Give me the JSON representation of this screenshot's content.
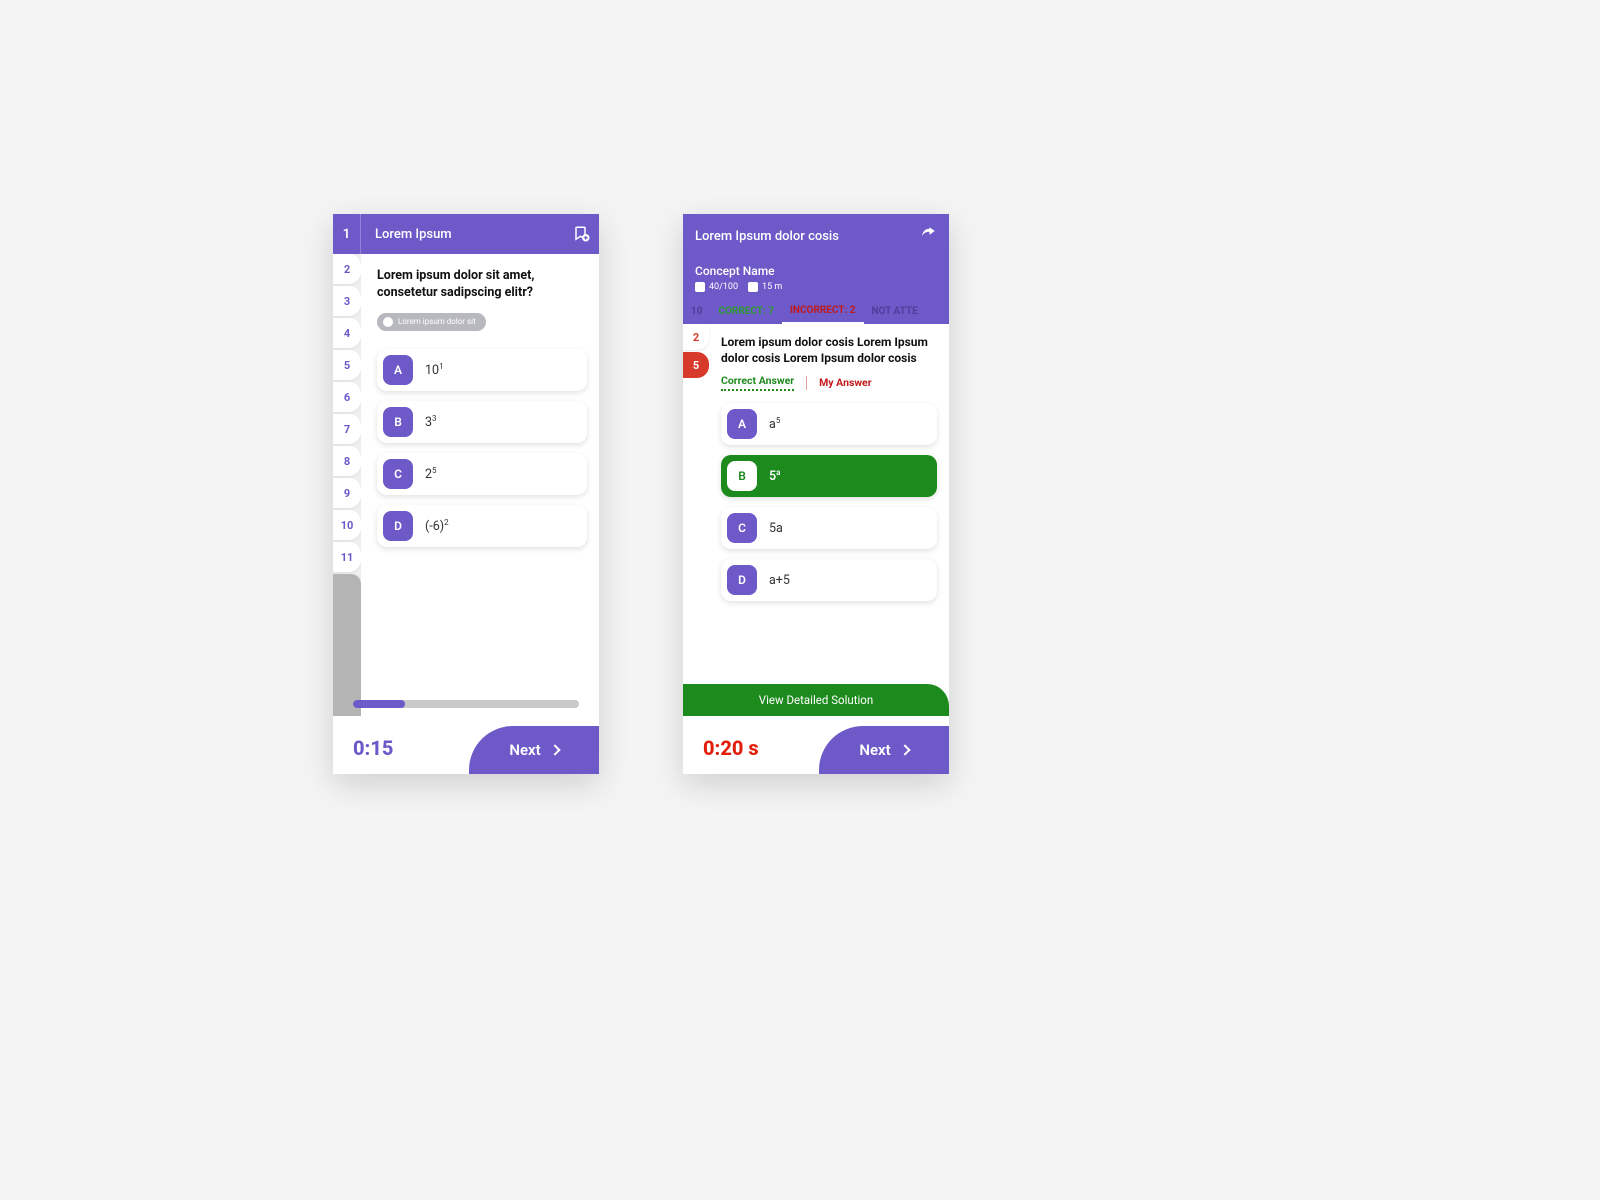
{
  "colors": {
    "primary": "#6d59c8",
    "green": "#1d8a1d",
    "red": "#d73a2a"
  },
  "quiz_screen": {
    "current_number": "1",
    "title": "Lorem Ipsum",
    "question_numbers": [
      "2",
      "3",
      "4",
      "5",
      "6",
      "7",
      "8",
      "9",
      "10",
      "11"
    ],
    "question_text": "Lorem ipsum dolor sit amet, consetetur sadipscing elitr?",
    "hint_chip": "Lorem ipsum dolor sit",
    "options": [
      {
        "letter": "A",
        "value": "10",
        "sup": "1"
      },
      {
        "letter": "B",
        "value": "3",
        "sup": "3"
      },
      {
        "letter": "C",
        "value": "2",
        "sup": "5"
      },
      {
        "letter": "D",
        "value": "(-6)",
        "sup": "2"
      }
    ],
    "progress_percent": 23,
    "timer": "0:15",
    "next_label": "Next"
  },
  "review_screen": {
    "title": "Lorem Ipsum dolor cosis",
    "concept_label": "Concept Name",
    "score": "40/100",
    "duration": "15 m",
    "stats_tabs": {
      "left_partial": "10",
      "correct": "CORRECT: 7",
      "incorrect": "INCORRECT: 2",
      "not_attempted": "NOT ATTE"
    },
    "red_tabs": [
      "2",
      "5"
    ],
    "question_text": "Lorem ipsum dolor cosis Lorem Ipsum dolor cosis Lorem Ipsum dolor cosis",
    "answer_tabs": {
      "correct": "Correct Answer",
      "mine": "My Answer"
    },
    "options": [
      {
        "letter": "A",
        "value": "a",
        "sup": "5",
        "correct": false
      },
      {
        "letter": "B",
        "value": "5",
        "sup": "a",
        "correct": true
      },
      {
        "letter": "C",
        "value": "5a",
        "sup": "",
        "correct": false
      },
      {
        "letter": "D",
        "value": "a+5",
        "sup": "",
        "correct": false
      }
    ],
    "solution_label": "View Detailed Solution",
    "timer": "0:20 s",
    "next_label": "Next"
  }
}
